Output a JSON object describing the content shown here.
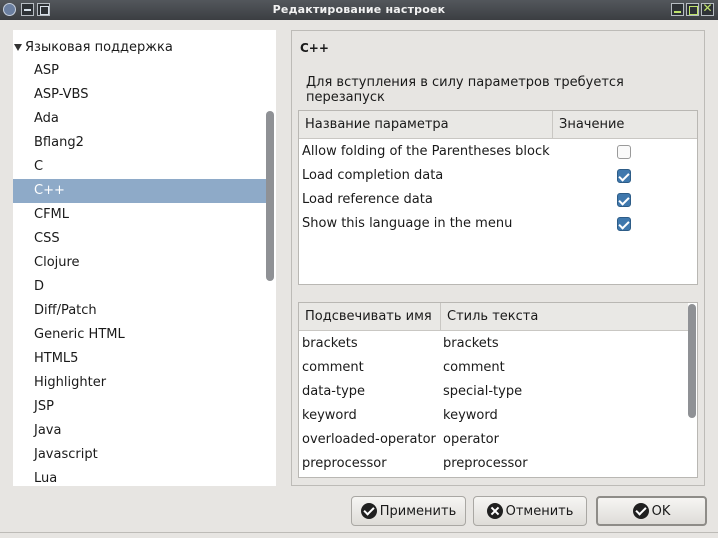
{
  "window": {
    "title": "Редактирование настроек"
  },
  "tree": {
    "root_label": "Языковая поддержка",
    "items": [
      "ASP",
      "ASP-VBS",
      "Ada",
      "Bflang2",
      "C",
      "C++",
      "CFML",
      "CSS",
      "Clojure",
      "D",
      "Diff/Patch",
      "Generic HTML",
      "HTML5",
      "Highlighter",
      "JSP",
      "Java",
      "Javascript",
      "Lua"
    ],
    "selected": "C++"
  },
  "pane": {
    "title": "C++",
    "restart_note": "Для вступления в силу параметров требуется перезапуск"
  },
  "options_table": {
    "headers": [
      "Название параметра",
      "Значение"
    ],
    "rows": [
      {
        "name": "Allow folding of the Parentheses block",
        "checked": false
      },
      {
        "name": "Load completion data",
        "checked": true
      },
      {
        "name": "Load reference data",
        "checked": true
      },
      {
        "name": "Show this language in the menu",
        "checked": true
      }
    ]
  },
  "highlight_table": {
    "headers": [
      "Подсвечивать имя",
      "Стиль текста"
    ],
    "rows": [
      {
        "name": "brackets",
        "style": "brackets"
      },
      {
        "name": "comment",
        "style": "comment"
      },
      {
        "name": "data-type",
        "style": "special-type"
      },
      {
        "name": "keyword",
        "style": "keyword"
      },
      {
        "name": "overloaded-operator",
        "style": "operator"
      },
      {
        "name": "preprocessor",
        "style": "preprocessor"
      }
    ]
  },
  "buttons": {
    "apply": "Применить",
    "cancel": "Отменить",
    "ok": "OK"
  },
  "colors": {
    "selection": "#8eaac8",
    "checkbox_on": "#3f78ad",
    "titlebar": "#45494e"
  }
}
